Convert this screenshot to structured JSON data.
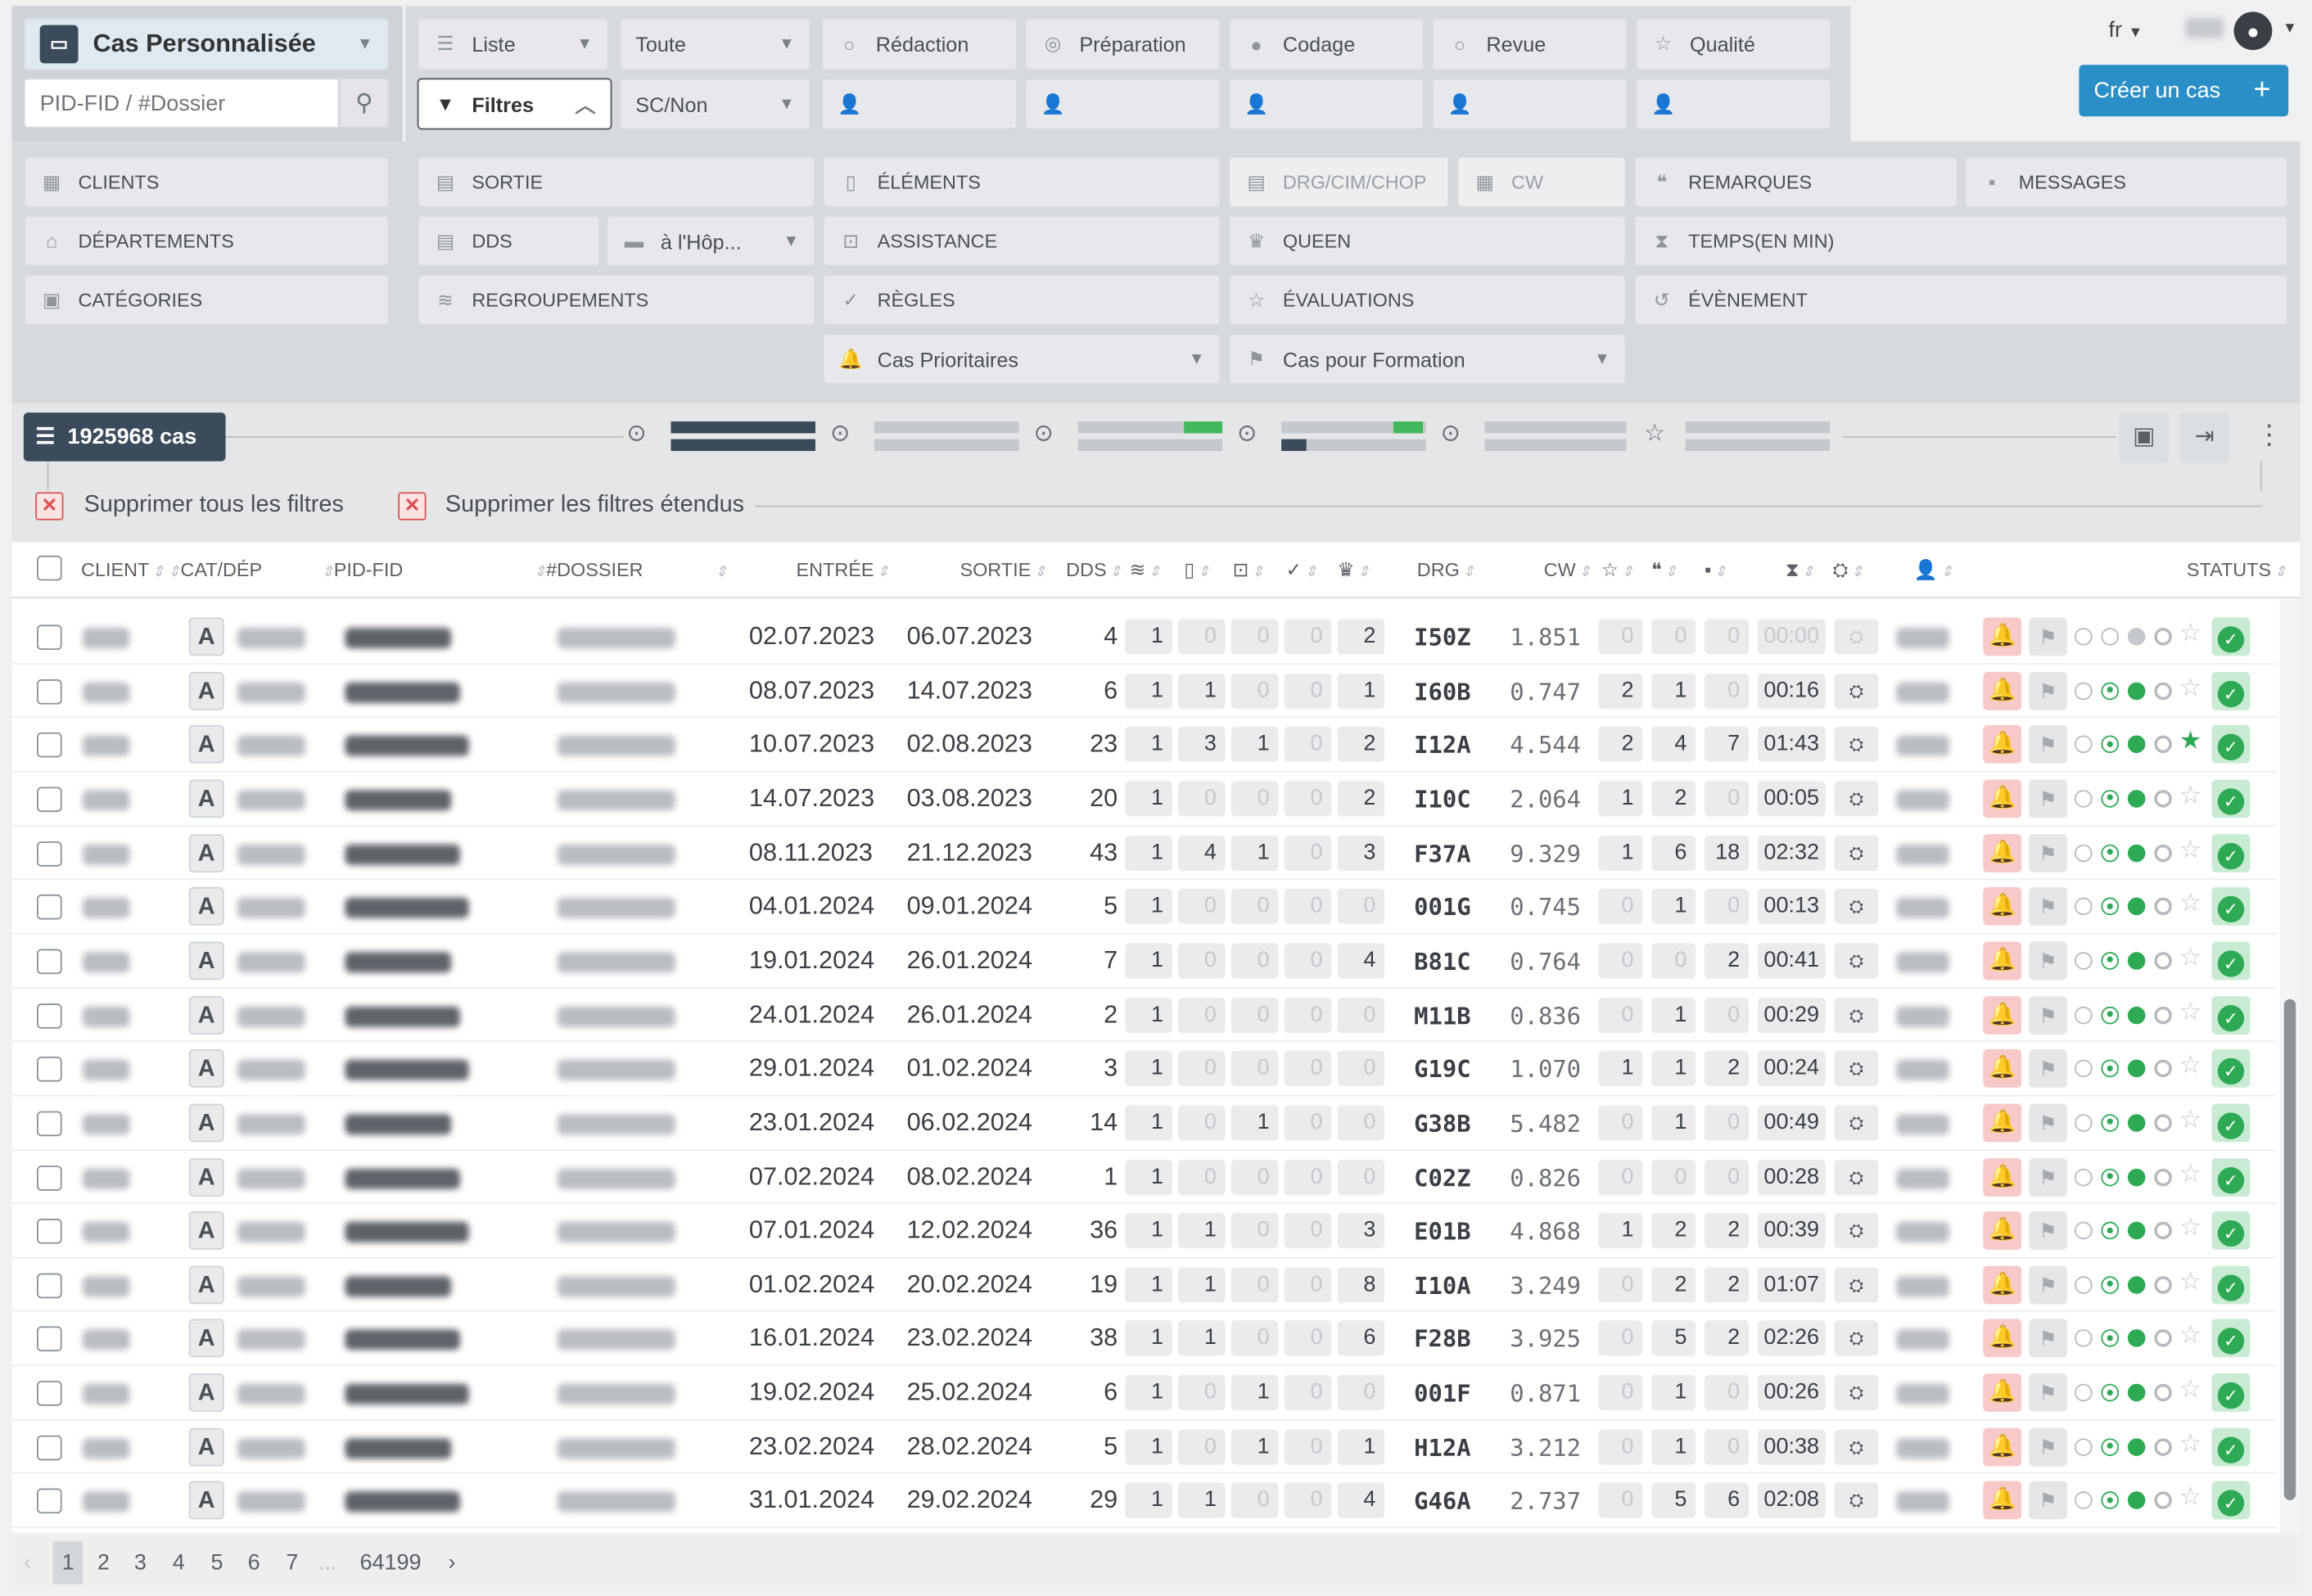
{
  "header": {
    "view_title": "Cas Personnalisée",
    "search_placeholder": "PID-FID / #Dossier",
    "liste": "Liste",
    "toute": "Toute",
    "filtres": "Filtres",
    "scnon": "SC/Non",
    "redaction": "Rédaction",
    "preparation": "Préparation",
    "codage": "Codage",
    "revue": "Revue",
    "qualite": "Qualité",
    "lang": "fr",
    "create_case": "Créer un cas"
  },
  "filters": {
    "clients": "CLIENTS",
    "departements": "DÉPARTEMENTS",
    "categories": "CATÉGORIES",
    "sortie": "SORTIE",
    "dds": "DDS",
    "hopital": "à l'Hôp...",
    "regroupements": "REGROUPEMENTS",
    "elements": "ÉLÉMENTS",
    "assistance": "ASSISTANCE",
    "regles": "RÈGLES",
    "cas_prioritaires": "Cas Prioritaires",
    "drg": "DRG/CIM/CHOP",
    "cw": "CW",
    "queen": "QUEEN",
    "evaluations": "ÉVALUATIONS",
    "cas_formation": "Cas pour Formation",
    "remarques": "REMARQUES",
    "messages": "MESSAGES",
    "temps": "TEMPS(EN MIN)",
    "evenement": "ÉVÈNEMENT"
  },
  "summary": {
    "count": "1925968 cas",
    "remove_all": "Supprimer tous les filtres",
    "remove_extended": "Supprimer les filtres étendus"
  },
  "columns": {
    "client": "CLIENT",
    "cat": "CAT/DÉP",
    "pid": "PID-FID",
    "dossier": "#DOSSIER",
    "entree": "ENTRÉE",
    "sortie": "SORTIE",
    "dds": "DDS",
    "drg": "DRG",
    "cw": "CW",
    "statuts": "STATUTS"
  },
  "rows": [
    {
      "cat": "A",
      "entree": "02.07.2023",
      "sortie": "06.07.2023",
      "dds": "4",
      "c": [
        "1",
        "0",
        "0",
        "0",
        "2"
      ],
      "drg": "I50Z",
      "cw": "1.851",
      "s": [
        "0",
        "0",
        "0"
      ],
      "time": "00:00",
      "green": 0,
      "star": false
    },
    {
      "cat": "A",
      "entree": "08.07.2023",
      "sortie": "14.07.2023",
      "dds": "6",
      "c": [
        "1",
        "1",
        "0",
        "0",
        "1"
      ],
      "drg": "I60B",
      "cw": "0.747",
      "s": [
        "2",
        "1",
        "0"
      ],
      "time": "00:16",
      "green": 2,
      "star": false
    },
    {
      "cat": "A",
      "entree": "10.07.2023",
      "sortie": "02.08.2023",
      "dds": "23",
      "c": [
        "1",
        "3",
        "1",
        "0",
        "2"
      ],
      "drg": "I12A",
      "cw": "4.544",
      "s": [
        "2",
        "4",
        "7"
      ],
      "time": "01:43",
      "green": 2,
      "star": true
    },
    {
      "cat": "A",
      "entree": "14.07.2023",
      "sortie": "03.08.2023",
      "dds": "20",
      "c": [
        "1",
        "0",
        "0",
        "0",
        "2"
      ],
      "drg": "I10C",
      "cw": "2.064",
      "s": [
        "1",
        "2",
        "0"
      ],
      "time": "00:05",
      "green": 2,
      "star": false
    },
    {
      "cat": "A",
      "entree": "08.11.2023",
      "sortie": "21.12.2023",
      "dds": "43",
      "c": [
        "1",
        "4",
        "1",
        "0",
        "3"
      ],
      "drg": "F37A",
      "cw": "9.329",
      "s": [
        "1",
        "6",
        "18"
      ],
      "time": "02:32",
      "green": 2,
      "star": false
    },
    {
      "cat": "A",
      "entree": "04.01.2024",
      "sortie": "09.01.2024",
      "dds": "5",
      "c": [
        "1",
        "0",
        "0",
        "0",
        "0"
      ],
      "drg": "001G",
      "cw": "0.745",
      "s": [
        "0",
        "1",
        "0"
      ],
      "time": "00:13",
      "green": 2,
      "star": false
    },
    {
      "cat": "A",
      "entree": "19.01.2024",
      "sortie": "26.01.2024",
      "dds": "7",
      "c": [
        "1",
        "0",
        "0",
        "0",
        "4"
      ],
      "drg": "B81C",
      "cw": "0.764",
      "s": [
        "0",
        "0",
        "2"
      ],
      "time": "00:41",
      "green": 2,
      "star": false
    },
    {
      "cat": "A",
      "entree": "24.01.2024",
      "sortie": "26.01.2024",
      "dds": "2",
      "c": [
        "1",
        "0",
        "0",
        "0",
        "0"
      ],
      "drg": "M11B",
      "cw": "0.836",
      "s": [
        "0",
        "1",
        "0"
      ],
      "time": "00:29",
      "green": 2,
      "star": false
    },
    {
      "cat": "A",
      "entree": "29.01.2024",
      "sortie": "01.02.2024",
      "dds": "3",
      "c": [
        "1",
        "0",
        "0",
        "0",
        "0"
      ],
      "drg": "G19C",
      "cw": "1.070",
      "s": [
        "1",
        "1",
        "2"
      ],
      "time": "00:24",
      "green": 2,
      "star": false
    },
    {
      "cat": "A",
      "entree": "23.01.2024",
      "sortie": "06.02.2024",
      "dds": "14",
      "c": [
        "1",
        "0",
        "1",
        "0",
        "0"
      ],
      "drg": "G38B",
      "cw": "5.482",
      "s": [
        "0",
        "1",
        "0"
      ],
      "time": "00:49",
      "green": 2,
      "star": false
    },
    {
      "cat": "A",
      "entree": "07.02.2024",
      "sortie": "08.02.2024",
      "dds": "1",
      "c": [
        "1",
        "0",
        "0",
        "0",
        "0"
      ],
      "drg": "C02Z",
      "cw": "0.826",
      "s": [
        "0",
        "0",
        "0"
      ],
      "time": "00:28",
      "green": 2,
      "star": false
    },
    {
      "cat": "A",
      "entree": "07.01.2024",
      "sortie": "12.02.2024",
      "dds": "36",
      "c": [
        "1",
        "1",
        "0",
        "0",
        "3"
      ],
      "drg": "E01B",
      "cw": "4.868",
      "s": [
        "1",
        "2",
        "2"
      ],
      "time": "00:39",
      "green": 2,
      "star": false
    },
    {
      "cat": "A",
      "entree": "01.02.2024",
      "sortie": "20.02.2024",
      "dds": "19",
      "c": [
        "1",
        "1",
        "0",
        "0",
        "8"
      ],
      "drg": "I10A",
      "cw": "3.249",
      "s": [
        "0",
        "2",
        "2"
      ],
      "time": "01:07",
      "green": 2,
      "star": false
    },
    {
      "cat": "A",
      "entree": "16.01.2024",
      "sortie": "23.02.2024",
      "dds": "38",
      "c": [
        "1",
        "1",
        "0",
        "0",
        "6"
      ],
      "drg": "F28B",
      "cw": "3.925",
      "s": [
        "0",
        "5",
        "2"
      ],
      "time": "02:26",
      "green": 2,
      "star": false
    },
    {
      "cat": "A",
      "entree": "19.02.2024",
      "sortie": "25.02.2024",
      "dds": "6",
      "c": [
        "1",
        "0",
        "1",
        "0",
        "0"
      ],
      "drg": "001F",
      "cw": "0.871",
      "s": [
        "0",
        "1",
        "0"
      ],
      "time": "00:26",
      "green": 2,
      "star": false
    },
    {
      "cat": "A",
      "entree": "23.02.2024",
      "sortie": "28.02.2024",
      "dds": "5",
      "c": [
        "1",
        "0",
        "1",
        "0",
        "1"
      ],
      "drg": "H12A",
      "cw": "3.212",
      "s": [
        "0",
        "1",
        "0"
      ],
      "time": "00:38",
      "green": 2,
      "star": false
    },
    {
      "cat": "A",
      "entree": "31.01.2024",
      "sortie": "29.02.2024",
      "dds": "29",
      "c": [
        "1",
        "1",
        "0",
        "0",
        "4"
      ],
      "drg": "G46A",
      "cw": "2.737",
      "s": [
        "0",
        "5",
        "6"
      ],
      "time": "02:08",
      "green": 2,
      "star": false
    }
  ],
  "pager": {
    "pages": [
      "1",
      "2",
      "3",
      "4",
      "5",
      "6",
      "7",
      "...",
      "64199"
    ],
    "prev": "‹",
    "next": "›"
  },
  "colors": {
    "accent": "#2b8fc7",
    "dark": "#3b4b5c",
    "green": "#2eaa55",
    "red": "#e03b3b"
  }
}
